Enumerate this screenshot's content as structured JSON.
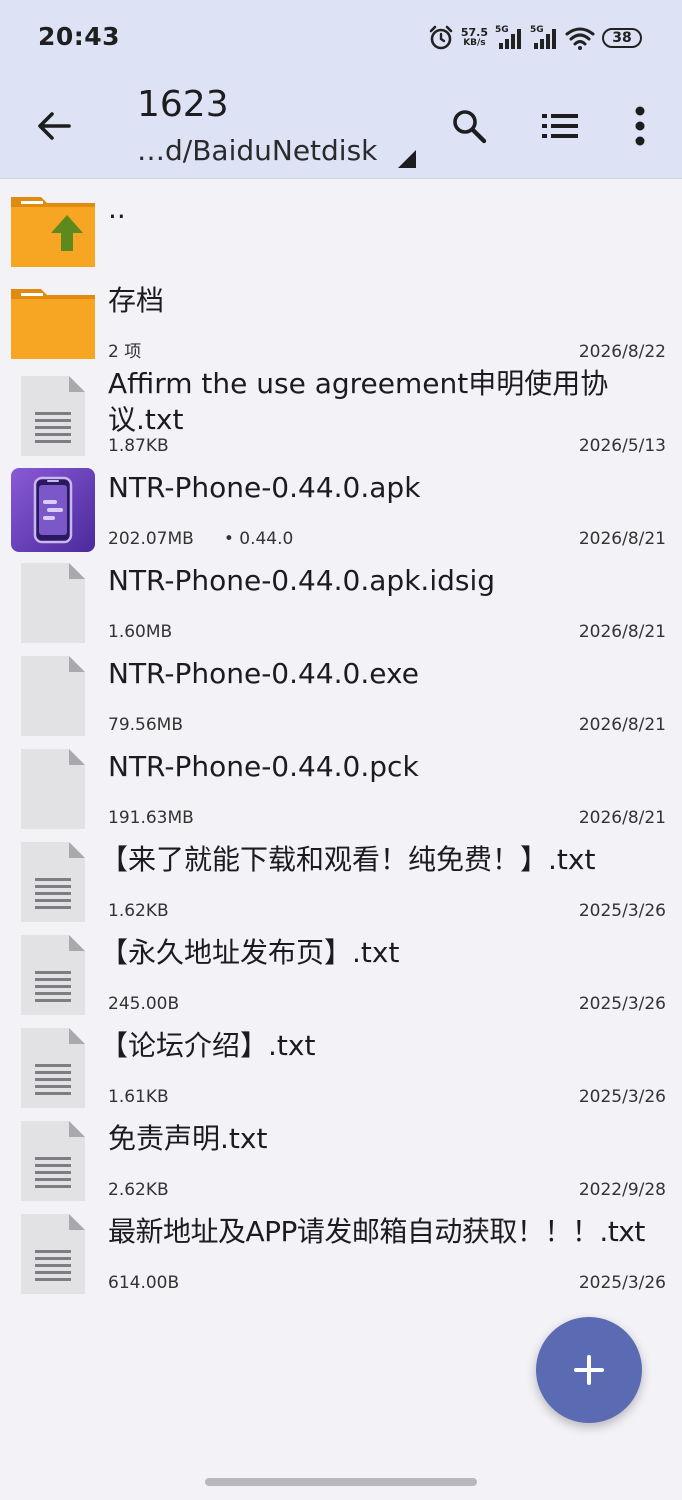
{
  "status_bar": {
    "time": "20:43",
    "net_speed_value": "57.5",
    "net_speed_unit": "KB/s",
    "signal1_label": "5G",
    "signal2_label": "5G",
    "battery": "38"
  },
  "toolbar": {
    "title": "1623",
    "path": "…d/BaiduNetdisk"
  },
  "files": [
    {
      "name": "..",
      "meta": "",
      "date": "",
      "type": "parent-folder"
    },
    {
      "name": "存档",
      "meta": "2 项",
      "date": "2026/8/22",
      "type": "folder"
    },
    {
      "name": "Affirm the use agreement申明使用协议.txt",
      "meta": "1.87KB",
      "date": "2026/5/13",
      "type": "text"
    },
    {
      "name": "NTR-Phone-0.44.0.apk",
      "meta": "202.07MB",
      "version": "• 0.44.0",
      "date": "2026/8/21",
      "type": "apk"
    },
    {
      "name": "NTR-Phone-0.44.0.apk.idsig",
      "meta": "1.60MB",
      "date": "2026/8/21",
      "type": "blank"
    },
    {
      "name": "NTR-Phone-0.44.0.exe",
      "meta": "79.56MB",
      "date": "2026/8/21",
      "type": "blank"
    },
    {
      "name": "NTR-Phone-0.44.0.pck",
      "meta": "191.63MB",
      "date": "2026/8/21",
      "type": "blank"
    },
    {
      "name": "【来了就能下载和观看！纯免费！】.txt",
      "meta": "1.62KB",
      "date": "2025/3/26",
      "type": "text"
    },
    {
      "name": "【永久地址发布页】.txt",
      "meta": "245.00B",
      "date": "2025/3/26",
      "type": "text"
    },
    {
      "name": "【论坛介绍】.txt",
      "meta": "1.61KB",
      "date": "2025/3/26",
      "type": "text"
    },
    {
      "name": "免责声明.txt",
      "meta": "2.62KB",
      "date": "2022/9/28",
      "type": "text"
    },
    {
      "name": "最新地址及APP请发邮箱自动获取！！！.txt",
      "meta": "614.00B",
      "date": "2025/3/26",
      "type": "text"
    }
  ],
  "icons": {
    "back": "arrow-left-icon",
    "search": "search-icon",
    "view": "list-view-icon",
    "more": "more-vert-icon",
    "fab": "plus-icon"
  },
  "colors": {
    "toolbar_bg": "#dde3f4",
    "folder": "#f6a623",
    "fab": "#5a6bb3",
    "apk_icon": "#6a3fbf"
  }
}
